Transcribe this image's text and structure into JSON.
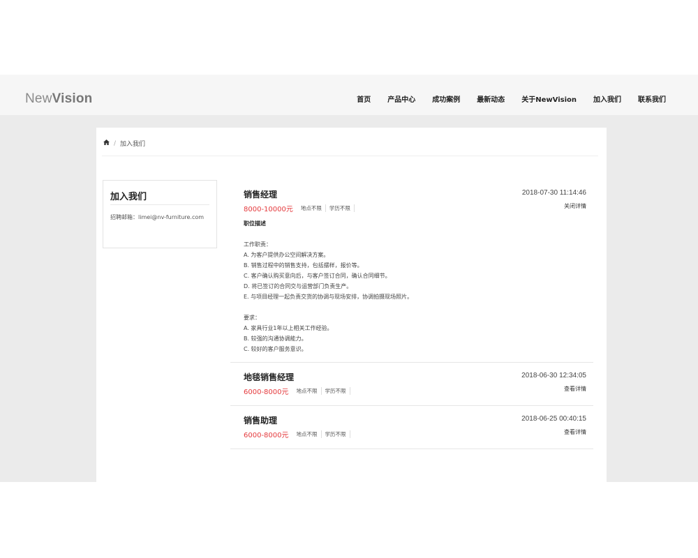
{
  "header": {
    "logo_part1": "New",
    "logo_part2": "Vision",
    "nav": [
      "首页",
      "产品中心",
      "成功案例",
      "最新动态",
      "关于NewVision",
      "加入我们",
      "联系我们"
    ]
  },
  "breadcrumb": {
    "current": "加入我们"
  },
  "sidebar": {
    "title": "加入我们",
    "email": "招聘邮箱：limei@nv-furniture.com"
  },
  "jobs": [
    {
      "title": "销售经理",
      "salary": "8000-10000元",
      "location": "地点不限",
      "education": "学历不限",
      "date": "2018-07-30 11:14:46",
      "action": "关闭详情",
      "desc_heading": "职位描述",
      "desc_lines": [
        "工作职责：",
        "A. 为客户提供办公空间解决方案。",
        "B. 销售过程中的销售支持，包括摆样，报价等。",
        "C. 客户确认购买意向后，与客户签订合同，确认合同细节。",
        "D. 将已签订的合同交与运营部门负责生产。",
        "E. 与项目经理一起负责交货的协调与现场安排，协调拍摄现场照片。",
        "",
        "要求：",
        "A. 家具行业1年以上相关工作经验。",
        "B. 较强的沟通协调能力。",
        "C. 较好的客户服务意识。"
      ]
    },
    {
      "title": "地毯销售经理",
      "salary": "6000-8000元",
      "location": "地点不限",
      "education": "学历不限",
      "date": "2018-06-30 12:34:05",
      "action": "查看详情"
    },
    {
      "title": "销售助理",
      "salary": "6000-8000元",
      "location": "地点不限",
      "education": "学历不限",
      "date": "2018-06-25 00:40:15",
      "action": "查看详情"
    }
  ]
}
